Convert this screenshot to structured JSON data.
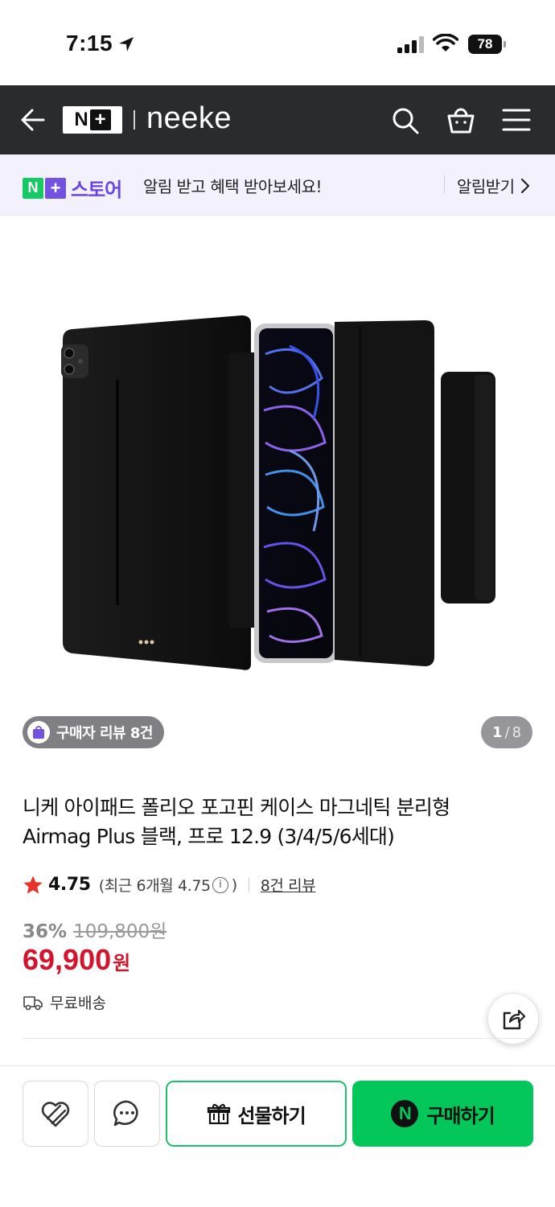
{
  "status_bar": {
    "time": "7:15",
    "battery": "78"
  },
  "header": {
    "brand_prefix": "N",
    "brand_plus": "+",
    "brand_name": "neeke"
  },
  "promo": {
    "logo_n": "N",
    "logo_plus": "+",
    "store_label": "스토어",
    "message": "알림 받고 혜택 받아보세요!",
    "action_label": "알림받기"
  },
  "gallery": {
    "review_badge": "구매자 리뷰 8건",
    "current_index": "1",
    "separator": "/",
    "total": "8"
  },
  "product": {
    "title": "니케 아이패드 폴리오 포고핀 케이스 마그네틱 분리형 Airmag Plus 블랙, 프로 12.9 (3/4/5/6세대)",
    "rating": "4.75",
    "rating_recent_prefix": "(최근 6개월 4.75",
    "rating_recent_suffix": ")",
    "review_link": "8건 리뷰",
    "discount_rate": "36%",
    "original_price": "109,800원",
    "sale_amount": "69,900",
    "sale_unit": "원",
    "shipping": "무료배송"
  },
  "bottom_bar": {
    "gift_label": "선물하기",
    "buy_label": "구매하기",
    "buy_icon_letter": "N"
  },
  "colors": {
    "accent_green": "#03c75a",
    "sale_red": "#d2152d",
    "store_purple": "#6b46e5",
    "header_dark": "#2a2b2d"
  },
  "icons": [
    "location-arrow-icon",
    "signal-icon",
    "wifi-icon",
    "battery-icon",
    "back-arrow-icon",
    "search-icon",
    "cart-icon",
    "menu-icon",
    "chevron-right-icon",
    "shopping-bag-icon",
    "star-icon",
    "info-icon",
    "truck-icon",
    "share-icon",
    "heart-icon",
    "chat-bubble-icon",
    "gift-icon",
    "naver-n-icon"
  ]
}
